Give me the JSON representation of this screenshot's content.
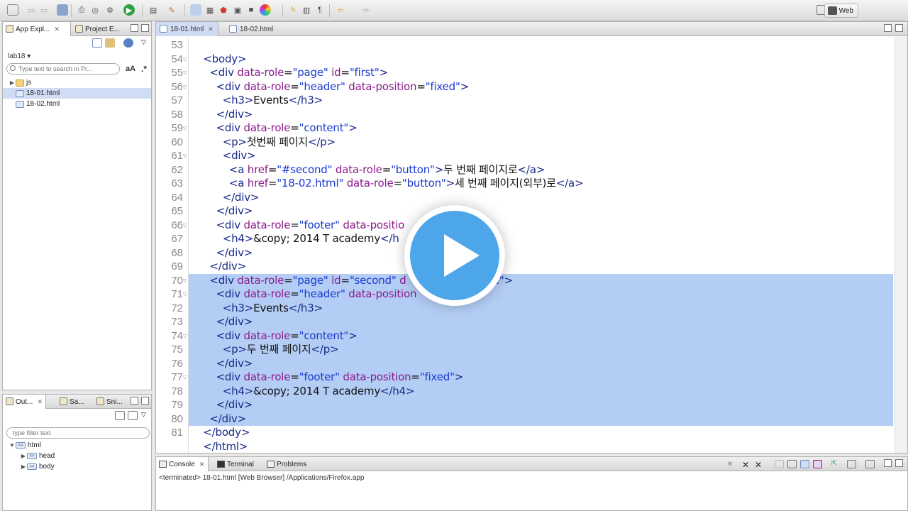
{
  "colors": {
    "selection": "#b3cdf5",
    "tag": "#1a2a8a",
    "attr": "#8b1a8b",
    "value": "#1a3ad0",
    "play_button": "#4ea6ea"
  },
  "toolbar": {
    "perspective_label": "Web"
  },
  "explorer": {
    "tabs": [
      {
        "label": "App Expl...",
        "icon": "app-explorer-icon"
      },
      {
        "label": "Project E...",
        "icon": "project-explorer-icon"
      }
    ],
    "project": "lab18 ▾",
    "search_placeholder": "Type text to search in Pr...",
    "case_toggle": "aA",
    "regex_toggle": ".*",
    "tree": [
      {
        "label": "js",
        "type": "folder",
        "selected": false
      },
      {
        "label": "18-01.html",
        "type": "html",
        "selected": true
      },
      {
        "label": "18-02.html",
        "type": "html",
        "selected": false
      }
    ]
  },
  "outline": {
    "tabs": [
      {
        "label": "Out..."
      },
      {
        "label": "Sa..."
      },
      {
        "label": "Sni..."
      }
    ],
    "filter_placeholder": "type filter text",
    "tree": [
      {
        "label": "html",
        "depth": 0,
        "expanded": true
      },
      {
        "label": "head",
        "depth": 1,
        "expanded": false
      },
      {
        "label": "body",
        "depth": 1,
        "expanded": false
      }
    ]
  },
  "editor": {
    "tabs": [
      {
        "label": "18-01.html",
        "active": true
      },
      {
        "label": "18-02.html",
        "active": false
      }
    ],
    "lines": [
      {
        "n": "53",
        "text": "",
        "fold": false,
        "selected": false
      },
      {
        "n": "54",
        "text": "<body>",
        "fold": true,
        "selected": false
      },
      {
        "n": "55",
        "text": "  <div data-role=\"page\" id=\"first\">",
        "fold": true,
        "selected": false
      },
      {
        "n": "56",
        "text": "    <div data-role=\"header\" data-position=\"fixed\">",
        "fold": true,
        "selected": false
      },
      {
        "n": "57",
        "text": "      <h3>Events</h3>",
        "fold": false,
        "selected": false
      },
      {
        "n": "58",
        "text": "    </div>",
        "fold": false,
        "selected": false
      },
      {
        "n": "59",
        "text": "    <div data-role=\"content\">",
        "fold": true,
        "selected": false
      },
      {
        "n": "60",
        "text": "      <p>첫번째 페이지</p>",
        "fold": false,
        "selected": false
      },
      {
        "n": "61",
        "text": "      <div>",
        "fold": true,
        "selected": false
      },
      {
        "n": "62",
        "text": "        <a href=\"#second\" data-role=\"button\">두 번째 페이지로</a>",
        "fold": false,
        "selected": false
      },
      {
        "n": "63",
        "text": "        <a href=\"18-02.html\" data-role=\"button\">세 번째 페이지(외부)로</a>",
        "fold": false,
        "selected": false
      },
      {
        "n": "64",
        "text": "      </div>",
        "fold": false,
        "selected": false
      },
      {
        "n": "65",
        "text": "    </div>",
        "fold": false,
        "selected": false
      },
      {
        "n": "66",
        "text": "    <div data-role=\"footer\" data-positio",
        "fold": true,
        "selected": false
      },
      {
        "n": "67",
        "text": "      <h4>&copy; 2014 T academy</h",
        "fold": false,
        "selected": false
      },
      {
        "n": "68",
        "text": "    </div>",
        "fold": false,
        "selected": false
      },
      {
        "n": "69",
        "text": "  </div>",
        "fold": false,
        "selected": false
      },
      {
        "n": "70",
        "text": "  <div data-role=\"page\" id=\"second\" d                n=\"true\">",
        "fold": true,
        "selected": true
      },
      {
        "n": "71",
        "text": "    <div data-role=\"header\" data-position",
        "fold": true,
        "selected": true
      },
      {
        "n": "72",
        "text": "      <h3>Events</h3>",
        "fold": false,
        "selected": true
      },
      {
        "n": "73",
        "text": "    </div>",
        "fold": false,
        "selected": true
      },
      {
        "n": "74",
        "text": "    <div data-role=\"content\">",
        "fold": true,
        "selected": true
      },
      {
        "n": "75",
        "text": "      <p>두 번째 페이지</p>",
        "fold": false,
        "selected": true
      },
      {
        "n": "76",
        "text": "    </div>",
        "fold": false,
        "selected": true
      },
      {
        "n": "77",
        "text": "    <div data-role=\"footer\" data-position=\"fixed\">",
        "fold": true,
        "selected": true
      },
      {
        "n": "78",
        "text": "      <h4>&copy; 2014 T academy</h4>",
        "fold": false,
        "selected": true
      },
      {
        "n": "79",
        "text": "    </div>",
        "fold": false,
        "selected": true
      },
      {
        "n": "80",
        "text": "  </div>",
        "fold": false,
        "selected": true
      },
      {
        "n": "81",
        "text": "</body>",
        "fold": false,
        "selected": false
      },
      {
        "n": "",
        "text": "</html>",
        "fold": false,
        "selected": false
      }
    ]
  },
  "console": {
    "tabs": [
      {
        "label": "Console",
        "active": true
      },
      {
        "label": "Terminal",
        "active": false
      },
      {
        "label": "Problems",
        "active": false
      }
    ],
    "status": "<terminated> 18-01.html [Web Browser] /Applications/Firefox.app"
  }
}
